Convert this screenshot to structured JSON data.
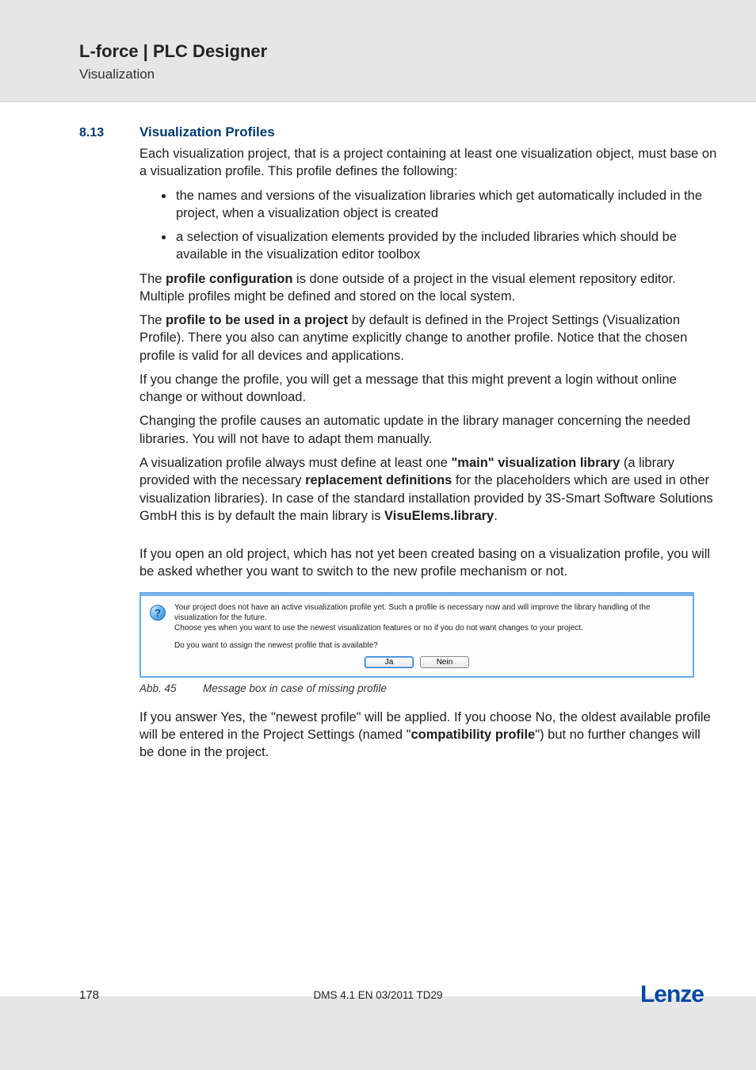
{
  "header": {
    "title": "L-force | PLC Designer",
    "subtitle": "Visualization"
  },
  "section": {
    "number": "8.13",
    "title": "Visualization Profiles"
  },
  "para_intro": "Each visualization project, that is a project containing at least one visualization object, must base on a visualization profile. This profile defines the following:",
  "bullets": [
    "the names and versions of the visualization libraries which get automatically included in the project, when a visualization object is created",
    "a selection of visualization elements provided by the included libraries which should be available in the visualization editor toolbox"
  ],
  "para_profile_cfg": {
    "prefix": "The ",
    "bold": "profile configuration",
    "rest": " is done outside of a project in the visual element repository editor. Multiple profiles might be defined and stored on the local system."
  },
  "para_profile_default": {
    "prefix": "The ",
    "bold": "profile to be used in a project",
    "rest": " by default is defined in the Project Settings (Visualization Profile). There you also can anytime explicitly change to another profile. Notice that the chosen profile is valid for all devices and applications."
  },
  "para_change_msg": "If you change the profile, you will get a message that this might prevent a login without online change or without download.",
  "para_auto_update": "Changing the profile causes an automatic update in the library manager concerning the needed libraries. You will not have to adapt them manually.",
  "para_main_lib": {
    "p1": "A visualization profile always must define at least one ",
    "b1": "\"main\" visualization library",
    "p2": " (a library provided with the necessary ",
    "b2": "replacement definitions",
    "p3": " for the placeholders which are used in other visualization libraries). In case of the standard installation provided by 3S-Smart Software Solutions GmbH this is by default the main library is ",
    "b3": "VisuElems.library",
    "p4": "."
  },
  "para_old_project": "If you open an old project, which has not yet been created basing on a visualization profile, you will be asked whether you want to switch to the new profile mechanism or not.",
  "msgbox": {
    "line1": "Your project does not have an active visualization profile yet. Such a profile is necessary now and will improve the library handling of the visualization for the future.",
    "line2": "Choose yes when you want to use the newest visualization features or no if you do not want changes to your project.",
    "question": "Do you want to assign the newest profile that is available?",
    "yes": "Ja",
    "no": "Nein"
  },
  "caption": {
    "label": "Abb. 45",
    "text": "Message box in case of missing profile"
  },
  "para_answer": {
    "p1": "If you answer Yes, the \"newest profile\" will be applied. If you choose No, the oldest available profile will be entered in the Project Settings (named \"",
    "b1": "compatibility profile",
    "p2": "\") but no further changes will be done in the project."
  },
  "footer": {
    "page": "178",
    "docid": "DMS 4.1 EN 03/2011 TD29",
    "logo": "Lenze"
  }
}
